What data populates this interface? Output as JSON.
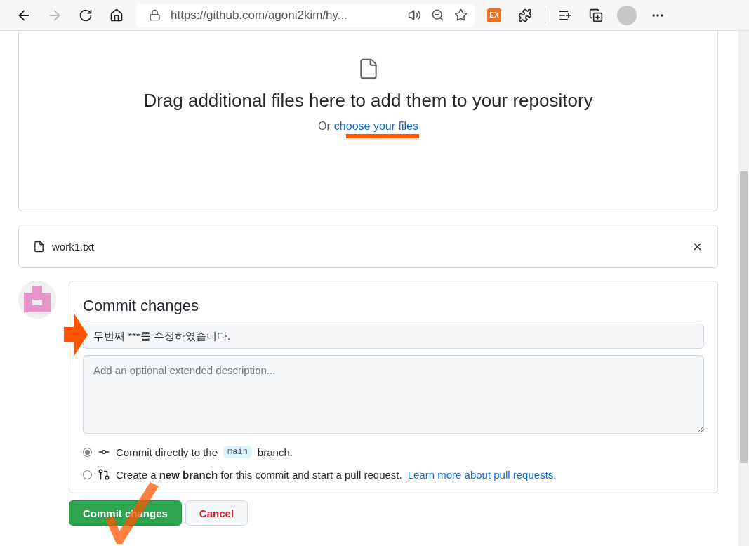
{
  "browser": {
    "url": "https://github.com/agoni2kim/hy...",
    "extension_badge": "EX"
  },
  "upload": {
    "heading": "Drag additional files here to add them to your repository",
    "prefix": "Or",
    "link": "choose your files"
  },
  "files": [
    {
      "name": "work1.txt"
    }
  ],
  "commit": {
    "title": "Commit changes",
    "summary": "두번째 ***를 수정하였습니다.",
    "description_placeholder": "Add an optional extended description...",
    "options": [
      {
        "kind": "direct",
        "selected": true,
        "before": "Commit directly to the",
        "branch": "main",
        "after": "branch."
      },
      {
        "kind": "new_branch",
        "selected": false,
        "text": "Create a **new branch** for this commit and start a pull request.",
        "link": "Learn more about pull requests."
      }
    ]
  },
  "buttons": [
    {
      "kind": "primary",
      "label": "Commit changes"
    },
    {
      "kind": "cancel",
      "label": "Cancel"
    }
  ]
}
